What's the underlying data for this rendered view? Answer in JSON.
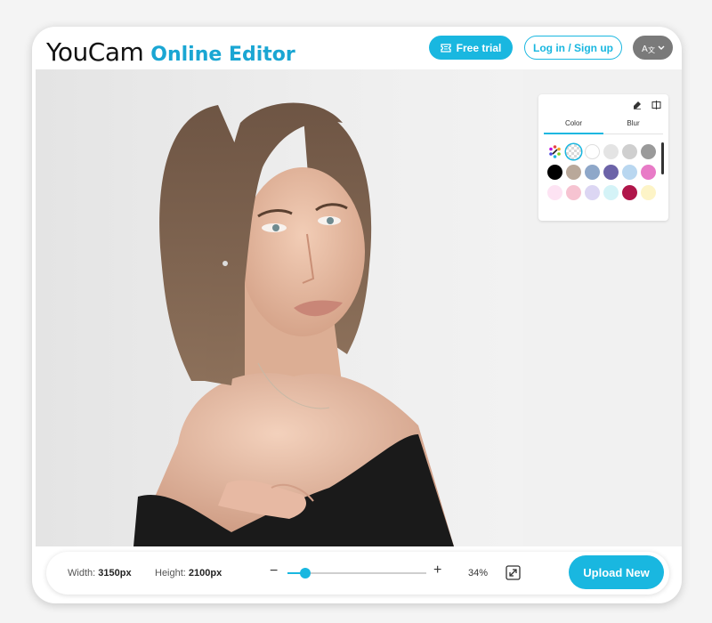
{
  "header": {
    "logo_main": "YouCam",
    "logo_sub": "Online Editor",
    "free_trial_label": "Free trial",
    "login_label": "Log in / Sign up",
    "language_icon": "translate-icon"
  },
  "panel": {
    "tabs": [
      {
        "label": "Color",
        "active": true
      },
      {
        "label": "Blur",
        "active": false
      }
    ],
    "tools": [
      "eraser-icon",
      "compare-icon"
    ],
    "swatch_rows": [
      [
        "picker",
        "transparent",
        "#ffffff",
        "#e4e4e4",
        "#cfcfcf",
        "#9a9a9a"
      ],
      [
        "#000000",
        "#b9a89a",
        "#8ea7c9",
        "#6c63a8",
        "#b9d7f0",
        "#e87bc7"
      ],
      [
        "#fde3f3",
        "#f6c3d1",
        "#dcd6f3",
        "#d4f3f7",
        "#b0164a",
        "#fdf4c7"
      ]
    ],
    "selected_swatch": "transparent"
  },
  "bottom_bar": {
    "width_label": "Width:",
    "width_value": "3150px",
    "height_label": "Height:",
    "height_value": "2100px",
    "zoom_minus": "−",
    "zoom_plus": "+",
    "zoom_level": "34%",
    "zoom_fraction": 0.13,
    "upload_label": "Upload New"
  },
  "colors": {
    "accent": "#19b7e0",
    "canvas_bg": "#ececec"
  }
}
